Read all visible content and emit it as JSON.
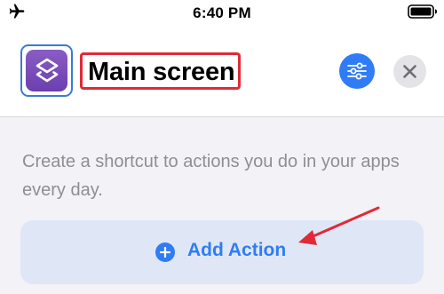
{
  "status_bar": {
    "time": "6:40 PM",
    "left_icon": "airplane-icon",
    "right_icon": "battery-icon"
  },
  "header": {
    "app_icon": "shortcuts-layers-icon",
    "title": "Main screen",
    "settings_icon": "sliders-icon",
    "close_icon": "close-icon"
  },
  "main": {
    "description": "Create a shortcut to actions you do in your apps every day.",
    "add_action": {
      "icon": "plus-circle-icon",
      "label": "Add Action"
    }
  },
  "colors": {
    "accent": "#2f7cf6",
    "highlight": "#e02a38",
    "app_icon_purple": "#7b4cba",
    "background": "#f2f2f7",
    "button_background": "#dfe7f7"
  }
}
